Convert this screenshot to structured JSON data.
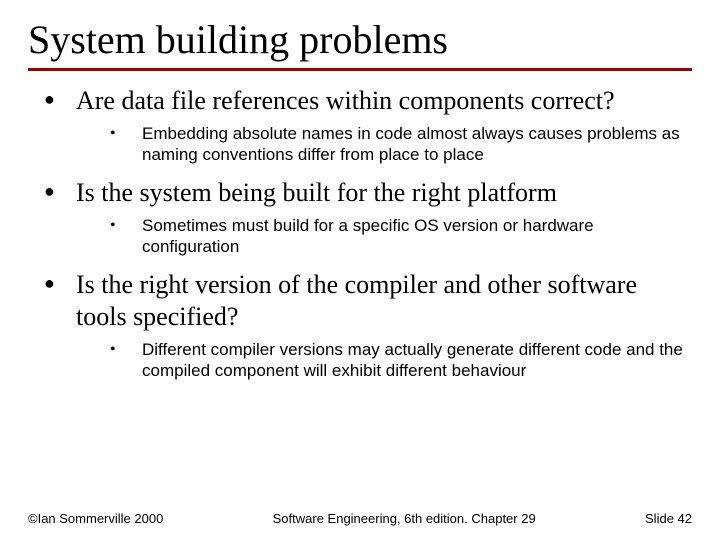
{
  "title": "System building problems",
  "bullets": [
    {
      "text": "Are data file references within components correct?",
      "sub": [
        "Embedding absolute names in code almost always causes problems as naming conventions differ from place to place"
      ]
    },
    {
      "text": "Is the system being built for the right platform",
      "sub": [
        "Sometimes must build for a specific OS version or hardware configuration"
      ]
    },
    {
      "text": "Is the right version of the compiler and other software tools specified?",
      "sub": [
        "Different compiler versions may actually generate different code and the compiled component will exhibit different behaviour"
      ]
    }
  ],
  "footer": {
    "left": "©Ian Sommerville 2000",
    "center": "Software Engineering, 6th edition. Chapter 29",
    "right": "Slide 42"
  }
}
